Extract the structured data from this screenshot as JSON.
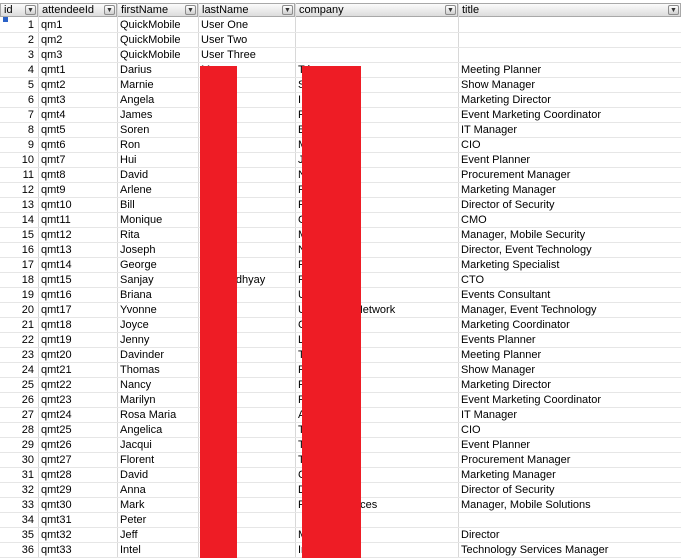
{
  "columns": [
    {
      "key": "id",
      "label": "id"
    },
    {
      "key": "attendeeId",
      "label": "attendeeId"
    },
    {
      "key": "firstName",
      "label": "firstName"
    },
    {
      "key": "lastName",
      "label": "lastName"
    },
    {
      "key": "company",
      "label": "company"
    },
    {
      "key": "title",
      "label": "title"
    }
  ],
  "rows": [
    {
      "id": "1",
      "attendeeId": "qm1",
      "firstName": "QuickMobile",
      "lastName": "User One",
      "company": "",
      "title": ""
    },
    {
      "id": "2",
      "attendeeId": "qm2",
      "firstName": "QuickMobile",
      "lastName": "User Two",
      "company": "",
      "title": ""
    },
    {
      "id": "3",
      "attendeeId": "qm3",
      "firstName": "QuickMobile",
      "lastName": "User Three",
      "company": "",
      "title": ""
    },
    {
      "id": "4",
      "attendeeId": "qmt1",
      "firstName": "Darius",
      "lastName": "M",
      "company": "T                 less",
      "title": "Meeting Planner"
    },
    {
      "id": "5",
      "attendeeId": "qmt2",
      "firstName": "Marnie",
      "lastName": "W",
      "company": "S                 p",
      "title": "Show Manager"
    },
    {
      "id": "6",
      "attendeeId": "qmt3",
      "firstName": "Angela",
      "lastName": "V",
      "company": "I",
      "title": "Marketing Director"
    },
    {
      "id": "7",
      "attendeeId": "qmt4",
      "firstName": "James",
      "lastName": "A",
      "company": "R                 ftware",
      "title": "Event Marketing Coordinator"
    },
    {
      "id": "8",
      "attendeeId": "qmt5",
      "firstName": "Soren",
      "lastName": "Da              d",
      "company": "B",
      "title": "IT Manager"
    },
    {
      "id": "9",
      "attendeeId": "qmt6",
      "firstName": "Ron",
      "lastName": "Si              n",
      "company": "M                 rs",
      "title": "CIO"
    },
    {
      "id": "10",
      "attendeeId": "qmt7",
      "firstName": "Hui",
      "lastName": "W",
      "company": "JI                 ernational",
      "title": "Event Planner"
    },
    {
      "id": "11",
      "attendeeId": "qmt8",
      "firstName": "David",
      "lastName": "Ro",
      "company": "N                 oods",
      "title": "Procurement Manager"
    },
    {
      "id": "12",
      "attendeeId": "qmt9",
      "firstName": "Arlene",
      "lastName": "Pe",
      "company": "P                 rest Inc.",
      "title": "Marketing Manager"
    },
    {
      "id": "13",
      "attendeeId": "qmt10",
      "firstName": "Bill",
      "lastName": "Fu",
      "company": "F",
      "title": "Director of Security"
    },
    {
      "id": "14",
      "attendeeId": "qmt11",
      "firstName": "Monique",
      "lastName": "Si              it",
      "company": "G                 elopment",
      "title": "CMO"
    },
    {
      "id": "15",
      "attendeeId": "qmt12",
      "firstName": "Rita",
      "lastName": "Ke",
      "company": "M                 plies",
      "title": "Manager, Mobile Security"
    },
    {
      "id": "16",
      "attendeeId": "qmt13",
      "firstName": "Joseph",
      "lastName": "Sc              ey",
      "company": "N                 Ltd.",
      "title": "Director, Event Technology"
    },
    {
      "id": "17",
      "attendeeId": "qmt14",
      "firstName": "George",
      "lastName": "De              hie",
      "company": "R",
      "title": "Marketing Specialist"
    },
    {
      "id": "18",
      "attendeeId": "qmt15",
      "firstName": "Sanjay",
      "lastName": "Ba              opadhyay",
      "company": "P",
      "title": "CTO"
    },
    {
      "id": "19",
      "attendeeId": "qmt16",
      "firstName": "Briana",
      "lastName": "La              elle",
      "company": "U",
      "title": "Events Consultant"
    },
    {
      "id": "20",
      "attendeeId": "qmt17",
      "firstName": "Yvonne",
      "lastName": "M",
      "company": "U                 Colleges Network",
      "title": "Manager, Event Technology"
    },
    {
      "id": "21",
      "attendeeId": "qmt18",
      "firstName": "Joyce",
      "lastName": "Yu",
      "company": "C",
      "title": "Marketing Coordinator"
    },
    {
      "id": "22",
      "attendeeId": "qmt19",
      "firstName": "Jenny",
      "lastName": "K",
      "company": "L                 Media",
      "title": "Events Planner"
    },
    {
      "id": "23",
      "attendeeId": "qmt20",
      "firstName": "Davinder",
      "lastName": "Dl",
      "company": "T                 uctions",
      "title": "Meeting Planner"
    },
    {
      "id": "24",
      "attendeeId": "qmt21",
      "firstName": "Thomas",
      "lastName": "Ke",
      "company": "R",
      "title": "Show Manager"
    },
    {
      "id": "25",
      "attendeeId": "qmt22",
      "firstName": "Nancy",
      "lastName": "Se",
      "company": "P                 pelines",
      "title": "Marketing Director"
    },
    {
      "id": "26",
      "attendeeId": "qmt23",
      "firstName": "Marilyn",
      "lastName": "Bo",
      "company": "F",
      "title": "Event Marketing Coordinator"
    },
    {
      "id": "27",
      "attendeeId": "qmt24",
      "firstName": "Rosa Maria",
      "lastName": "Ac",
      "company": "A",
      "title": "IT Manager"
    },
    {
      "id": "28",
      "attendeeId": "qmt25",
      "firstName": "Angelica",
      "lastName": "Re",
      "company": "T",
      "title": "CIO"
    },
    {
      "id": "29",
      "attendeeId": "qmt26",
      "firstName": "Jacqui",
      "lastName": "Ta",
      "company": "T                 ernational",
      "title": "Event Planner"
    },
    {
      "id": "30",
      "attendeeId": "qmt27",
      "firstName": "Florent",
      "lastName": "Bo",
      "company": "T                 oe",
      "title": "Procurement Manager"
    },
    {
      "id": "31",
      "attendeeId": "qmt28",
      "firstName": "David",
      "lastName": "Ro",
      "company": "C",
      "title": "Marketing Manager"
    },
    {
      "id": "32",
      "attendeeId": "qmt29",
      "firstName": "Anna",
      "lastName": "Ba              ian",
      "company": "D                 line",
      "title": "Director of Security"
    },
    {
      "id": "33",
      "attendeeId": "qmt30",
      "firstName": "Mark",
      "lastName": "Li",
      "company": "P                 ation Services",
      "title": "Manager, Mobile Solutions"
    },
    {
      "id": "34",
      "attendeeId": "qmt31",
      "firstName": "Peter",
      "lastName": "Sr",
      "company": "",
      "title": ""
    },
    {
      "id": "35",
      "attendeeId": "qmt32",
      "firstName": "Jeff",
      "lastName": "M              ter",
      "company": "M                 nsulting",
      "title": "Director"
    },
    {
      "id": "36",
      "attendeeId": "qmt33",
      "firstName": "Intel",
      "lastName": "Te",
      "company": "In",
      "title": "Technology Services Manager"
    }
  ],
  "colors": {
    "redaction": "#ee1c25",
    "gridline": "#d8d8d8",
    "header_bg": "#e6e6e6"
  },
  "icons": {
    "filter": "dropdown-arrow-icon"
  }
}
